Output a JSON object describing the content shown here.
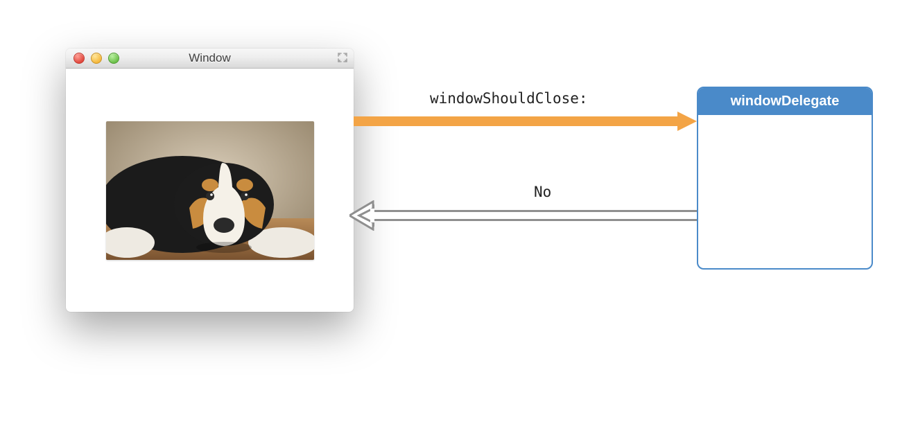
{
  "window": {
    "title": "Window",
    "traffic_lights": {
      "close": "close",
      "minimize": "minimize",
      "zoom": "zoom"
    },
    "fullscreen_icon": "fullscreen-icon",
    "image_alt": "puppy-photo"
  },
  "delegate": {
    "title": "windowDelegate"
  },
  "arrows": {
    "outgoing_message": "windowShouldClose:",
    "return_value": "No"
  },
  "colors": {
    "arrow_orange": "#f3a446",
    "arrow_grey": "#8f8f8f",
    "delegate_blue": "#4a8ac9"
  }
}
